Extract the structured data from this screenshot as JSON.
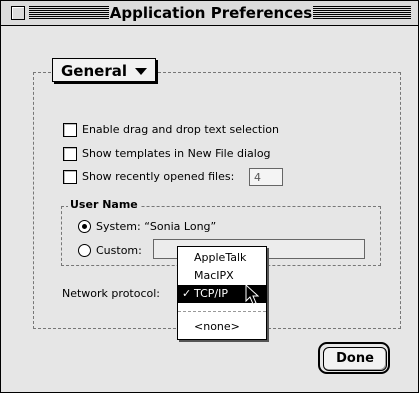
{
  "window": {
    "title": "Application Preferences"
  },
  "panel": {
    "selected": "General"
  },
  "options": [
    {
      "label": "Enable drag and drop text selection",
      "checked": false
    },
    {
      "label": "Show templates in New File dialog",
      "checked": false
    },
    {
      "label": "Show recently opened files:",
      "checked": false,
      "value": "4"
    }
  ],
  "user_name": {
    "title": "User Name",
    "system_label": "System: “Sonia Long”",
    "custom_label": "Custom:",
    "selected": "system",
    "custom_value": ""
  },
  "network": {
    "label": "Network protocol:",
    "items": [
      "AppleTalk",
      "MacIPX",
      "TCP/IP",
      "<none>"
    ],
    "selected": "TCP/IP",
    "check": "✓"
  },
  "buttons": {
    "done": "Done"
  }
}
